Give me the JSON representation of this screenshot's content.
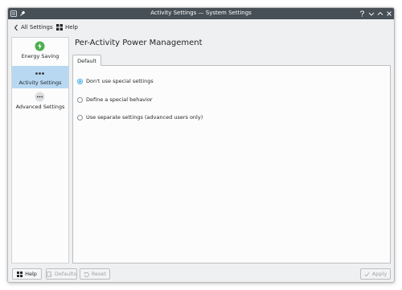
{
  "window": {
    "title": "Activity Settings — System Settings"
  },
  "toolbar": {
    "back_label": "All Settings",
    "help_label": "Help"
  },
  "sidebar": {
    "items": [
      {
        "label": "Energy Saving",
        "icon": "energy-saving-icon",
        "active": false
      },
      {
        "label": "Activity Settings",
        "icon": "activity-dots-icon",
        "active": true
      },
      {
        "label": "Advanced Settings",
        "icon": "advanced-dots-icon",
        "active": false
      }
    ]
  },
  "main": {
    "title": "Per-Activity Power Management",
    "tab": "Default",
    "options": [
      {
        "label": "Don't use special settings",
        "checked": true
      },
      {
        "label": "Define a special behavior",
        "checked": false
      },
      {
        "label": "Use separate settings (advanced users only)",
        "checked": false
      }
    ]
  },
  "footer": {
    "help_label": "Help",
    "defaults_label": "Defaults",
    "reset_label": "Reset",
    "apply_label": "Apply"
  },
  "colors": {
    "titlebar": "#475057",
    "accent": "#3daee9",
    "selection": "#b8d8f2",
    "energy_green": "#4caf50"
  }
}
